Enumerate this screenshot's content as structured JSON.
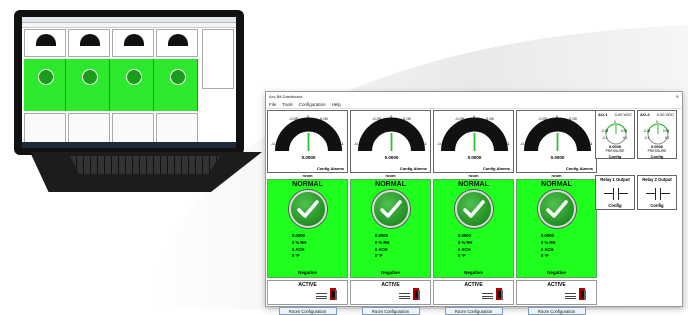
{
  "window": {
    "title": "Acc Bit Dashboard",
    "close": "✕"
  },
  "menu": [
    {
      "label": "File"
    },
    {
      "label": "Tools"
    },
    {
      "label": "Configuration"
    },
    {
      "label": "Help"
    }
  ],
  "rooms": [
    {
      "gauge": {
        "ticks": [
          "-0.05",
          "0",
          "0.05"
        ],
        "min": "-0.1",
        "max": "0.1",
        "value": "0.0000",
        "config": "Config Alarms"
      },
      "room_label": "room",
      "status": "NORMAL",
      "readings": [
        "0.0000",
        "0 % RH",
        "0 ACH",
        "0 °F"
      ],
      "pressure": "Negative",
      "state": "ACTIVE",
      "button": "Room Configuration"
    },
    {
      "gauge": {
        "ticks": [
          "-0.05",
          "0",
          "0.05"
        ],
        "min": "-0.1",
        "max": "0.1",
        "value": "0.0000",
        "config": "Config Alarms"
      },
      "room_label": "room",
      "status": "NORMAL",
      "readings": [
        "0.0000",
        "0 % RH",
        "0 ACH",
        "0 °F"
      ],
      "pressure": "Negative",
      "state": "ACTIVE",
      "button": "Room Configuration"
    },
    {
      "gauge": {
        "ticks": [
          "-0.05",
          "0",
          "0.05"
        ],
        "min": "-0.1",
        "max": "0.1",
        "value": "0.0000",
        "config": "Config Alarms"
      },
      "room_label": "room",
      "status": "NORMAL",
      "readings": [
        "0.0000",
        "0 % RH",
        "0 ACH",
        "0 °F"
      ],
      "pressure": "Negative",
      "state": "ACTIVE",
      "button": "Room Configuration"
    },
    {
      "gauge": {
        "ticks": [
          "-0.05",
          "0",
          "0.05"
        ],
        "min": "-0.1",
        "max": "0.1",
        "value": "0.0000",
        "config": "Config Alarms"
      },
      "room_label": "room",
      "status": "NORMAL",
      "readings": [
        "0.0000",
        "0 % RH",
        "0 ACH",
        "0 °F"
      ],
      "pressure": "Negative",
      "state": "ACTIVE",
      "button": "Room Configuration"
    }
  ],
  "analog_outputs": [
    {
      "name": "AO-1",
      "vdc": "0.00 VDC",
      "ticks": [
        "0",
        "-0.05",
        "0.05",
        "-0.1",
        "0.1"
      ],
      "value": "0.0000",
      "label": "PRESSURE",
      "config": "Config"
    },
    {
      "name": "AO-2",
      "vdc": "0.00 VDC",
      "ticks": [
        "0",
        "-0.05",
        "0.05",
        "-0.1",
        "0.1"
      ],
      "value": "0.0000",
      "label": "PRESSURE",
      "config": "Config"
    }
  ],
  "relays": [
    {
      "title": "Relay 1 Output",
      "config": "Config"
    },
    {
      "title": "Relay 2 Output",
      "config": "Config"
    }
  ],
  "colors": {
    "normal_green": "#1eff1e",
    "check_green": "#128c12",
    "needle": "#2fbf2f"
  }
}
